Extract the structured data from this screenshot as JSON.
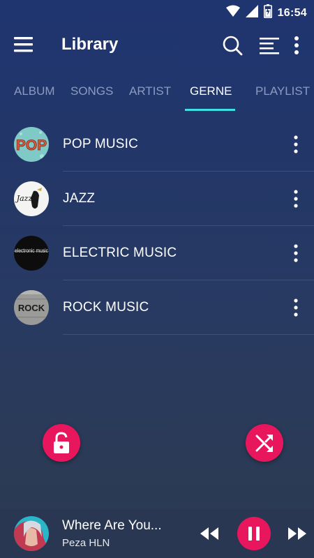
{
  "status_bar": {
    "time": "16:54",
    "icons": [
      "wifi-icon",
      "signal-icon",
      "battery-icon"
    ]
  },
  "app_bar": {
    "title": "Library",
    "icons": [
      "menu-icon",
      "search-icon",
      "sort-icon",
      "more-vert-icon"
    ]
  },
  "tabs": [
    {
      "label": "ALBUM",
      "active": false
    },
    {
      "label": "SONGS",
      "active": false
    },
    {
      "label": "ARTIST",
      "active": false
    },
    {
      "label": "GERNE",
      "active": true
    },
    {
      "label": "PLAYLIST",
      "active": false
    }
  ],
  "genres": [
    {
      "label": "POP MUSIC",
      "thumb_text": "POP"
    },
    {
      "label": "JAZZ",
      "thumb_text": "Jazz"
    },
    {
      "label": "ELECTRIC MUSIC",
      "thumb_text": "electronic music"
    },
    {
      "label": "ROCK MUSIC",
      "thumb_text": "ROCK"
    }
  ],
  "fabs": {
    "left_icon": "lock-open-icon",
    "right_icon": "shuffle-icon"
  },
  "now_playing": {
    "title": "Where Are You...",
    "artist": "Peza HLN",
    "controls": [
      "rewind-icon",
      "pause-icon",
      "fast-forward-icon"
    ]
  },
  "colors": {
    "accent": "#e8175d",
    "tab_indicator": "#3ee0e6",
    "inactive_tab": "#8c9bbf",
    "player_bg": "#2a3752"
  }
}
